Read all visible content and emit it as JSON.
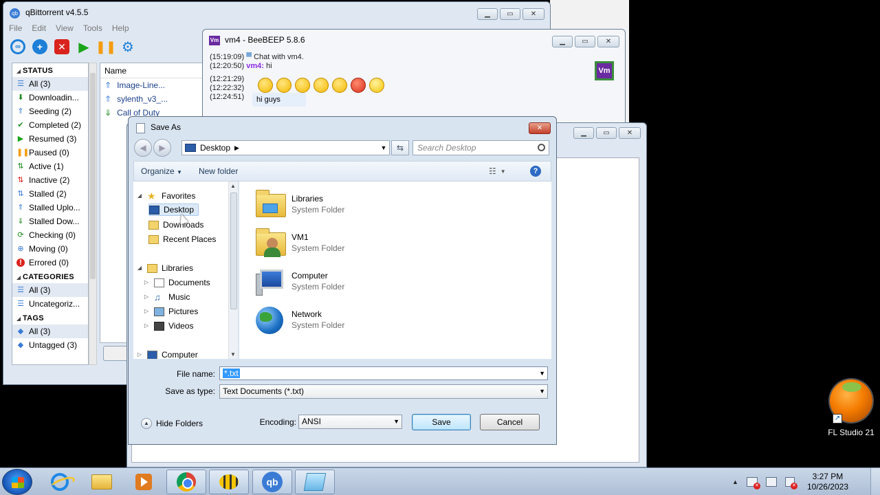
{
  "qbittorrent": {
    "title": "qBittorrent v4.5.5",
    "menu": [
      "File",
      "Edit",
      "View",
      "Tools",
      "Help"
    ],
    "status_header": "STATUS",
    "status_items": [
      "All (3)",
      "Downloadin...",
      "Seeding (2)",
      "Completed (2)",
      "Resumed (3)",
      "Paused (0)",
      "Active (1)",
      "Inactive (2)",
      "Stalled (2)",
      "Stalled Uplo...",
      "Stalled Dow...",
      "Checking (0)",
      "Moving (0)",
      "Errored (0)"
    ],
    "categories_header": "CATEGORIES",
    "category_items": [
      "All (3)",
      "Uncategoriz..."
    ],
    "tags_header": "TAGS",
    "tag_items": [
      "All (3)",
      "Untagged (3)"
    ],
    "list_header": "Name",
    "torrents": [
      "Image-Line...",
      "sylenth_v3_...",
      "Call of Duty"
    ]
  },
  "beebeep": {
    "title": "vm4 - BeeBEEP 5.8.6",
    "lines": [
      {
        "time": "(15:19:09)",
        "text": "Chat with vm4."
      },
      {
        "time": "(12:20:50)",
        "name": "vm4:",
        "text": "hi"
      },
      {
        "time": "(12:21:29)",
        "text": ""
      },
      {
        "time": "(12:22:32)",
        "text": "hi guys"
      },
      {
        "time": "(12:24:51)",
        "text": ""
      }
    ],
    "avatar": "Vm"
  },
  "dialog": {
    "title": "Save As",
    "address": "Desktop",
    "search_placeholder": "Search Desktop",
    "organize_label": "Organize",
    "new_folder_label": "New folder",
    "help_icon": "?",
    "nav": {
      "favorites": "Favorites",
      "desktop": "Desktop",
      "downloads": "Downloads",
      "recent": "Recent Places",
      "libraries": "Libraries",
      "documents": "Documents",
      "music": "Music",
      "pictures": "Pictures",
      "videos": "Videos",
      "computer": "Computer"
    },
    "items": [
      {
        "name": "Libraries",
        "type": "System Folder"
      },
      {
        "name": "VM1",
        "type": "System Folder"
      },
      {
        "name": "Computer",
        "type": "System Folder"
      },
      {
        "name": "Network",
        "type": "System Folder"
      }
    ],
    "file_name_label": "File name:",
    "file_name_value": "*.txt",
    "save_type_label": "Save as type:",
    "save_type_value": "Text Documents (*.txt)",
    "encoding_label": "Encoding:",
    "encoding_value": "ANSI",
    "save_button": "Save",
    "cancel_button": "Cancel",
    "hide_folders": "Hide Folders"
  },
  "desktop": {
    "fl_label": "FL Studio 21"
  },
  "taskbar": {
    "time": "3:27 PM",
    "date": "10/26/2023"
  }
}
